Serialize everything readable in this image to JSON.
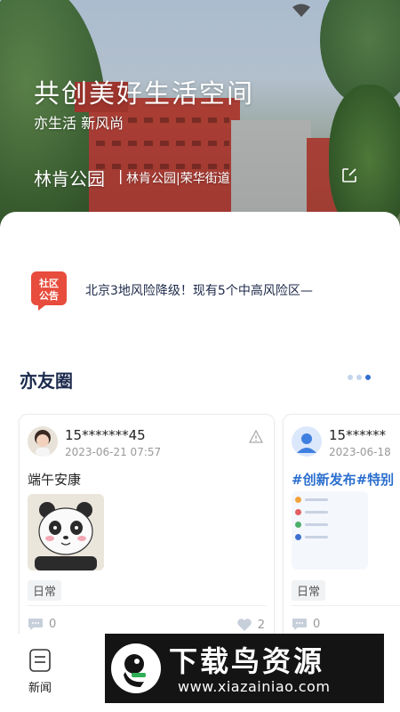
{
  "hero": {
    "title": "共创美好生活空间",
    "subtitle": "亦生活 新风尚",
    "location_name": "林肯公园",
    "location_separator": "|",
    "location_detail": "林肯公园|荣华街道"
  },
  "notice": {
    "badge_line1": "社区",
    "badge_line2": "公告",
    "text": "北京3地风险降级！现有5个中高风险区—"
  },
  "friends": {
    "title": "亦友圈",
    "posts": [
      {
        "user": "15*******45",
        "time": "2023-06-21  07:57",
        "text": "端午安康",
        "tag": "日常",
        "comments": "0",
        "likes": "2"
      },
      {
        "user": "15******",
        "time": "2023-06-18",
        "text": "#创新发布#特别",
        "tag": "日常",
        "comments": "0"
      }
    ]
  },
  "tabbar": {
    "news_label": "新闻"
  },
  "watermark": {
    "title": "下载鸟资源",
    "url": "www.xiazainiao.com"
  },
  "colors": {
    "accent": "#2f6fd0",
    "heading": "#1d2b4f",
    "notice_red": "#e74c3c"
  }
}
